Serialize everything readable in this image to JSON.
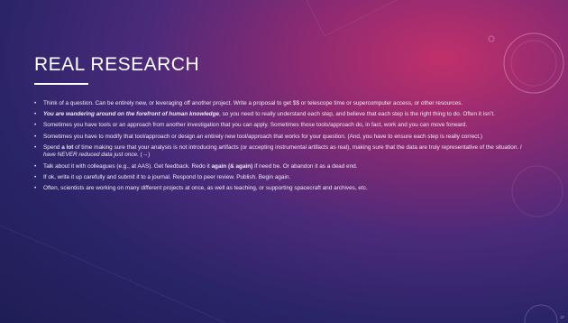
{
  "slide": {
    "title": "REAL RESEARCH",
    "page_number": "27",
    "bullets": [
      {
        "parts": [
          {
            "text": "Think of a question. Can be entirely new, or leveraging off another project. Write a proposal to get $$ or telescope time or supercomputer access, or other resources."
          }
        ]
      },
      {
        "parts": [
          {
            "text": "You are wandering around on the forefront of human knowledge",
            "style": "bold-italic"
          },
          {
            "text": ", so you need to really understand each step, and believe that each step is the right thing to do. Often it isn’t."
          }
        ]
      },
      {
        "parts": [
          {
            "text": "Sometimes you have tools or an approach from another investigation that you can apply. Sometimes those tools/approach do, in fact, work and you can move forward."
          }
        ]
      },
      {
        "parts": [
          {
            "text": "Sometimes you have to modify that tool/approach or design an entirely new tool/approach that works for your question. (And, you have to ensure each step is really correct.)"
          }
        ]
      },
      {
        "parts": [
          {
            "text": "Spend "
          },
          {
            "text": "a lot",
            "style": "bold"
          },
          {
            "text": " of time making sure that your analysis is not introducing artifacts (or accepting instrumental artifacts as real), making sure that the data are truly representative of the situation. "
          },
          {
            "text": "I have NEVER reduced data just once.",
            "style": "italic"
          },
          {
            "text": " (→)"
          }
        ]
      },
      {
        "parts": [
          {
            "text": "Talk about it with colleagues (e.g., at AAS). Get feedback. Redo it "
          },
          {
            "text": "again (& again)",
            "style": "bold"
          },
          {
            "text": " if need be. Or abandon it as a dead end."
          }
        ]
      },
      {
        "parts": [
          {
            "text": "If ok, write it up carefully and submit it to a journal. Respond to peer review. Publish. Begin again."
          }
        ]
      },
      {
        "parts": [
          {
            "text": "Often, scientists are working on many different projects at once, as well as teaching, or supporting spacecraft and archives, etc."
          }
        ]
      }
    ]
  },
  "colors": {
    "background_dark": "#1f1d55",
    "background_mid": "#4a2a7a",
    "background_glow": "#c0306a",
    "text": "#f1e9f3",
    "title": "#ffffff"
  }
}
